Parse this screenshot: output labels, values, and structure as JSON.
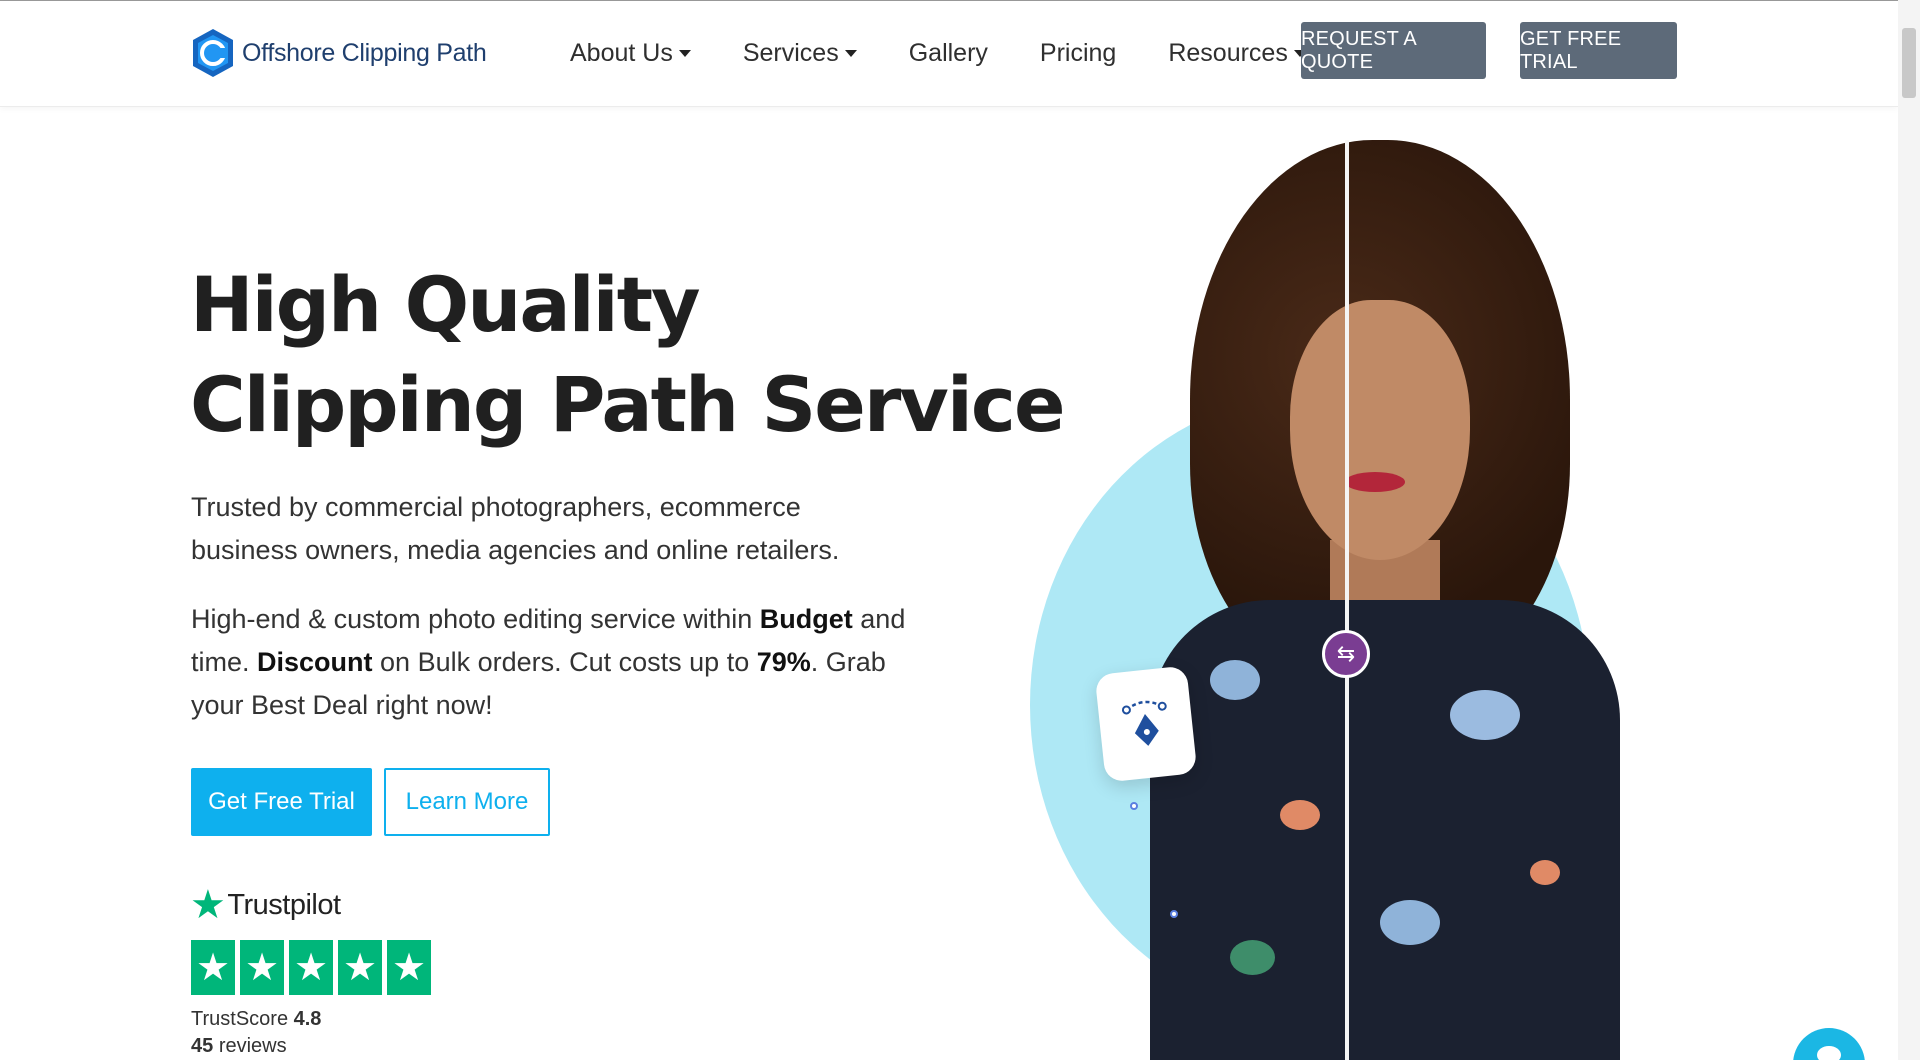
{
  "header": {
    "logo_text": "Offshore Clipping Path",
    "nav": [
      {
        "label": "About Us",
        "dropdown": true
      },
      {
        "label": "Services",
        "dropdown": true
      },
      {
        "label": "Gallery",
        "dropdown": false
      },
      {
        "label": "Pricing",
        "dropdown": false
      },
      {
        "label": "Resources",
        "dropdown": true
      }
    ],
    "request_quote_label": "REQUEST A QUOTE",
    "free_trial_label": "GET FREE TRIAL"
  },
  "hero": {
    "title_line1": "High Quality",
    "title_line2": "Clipping Path Service",
    "paragraph1": "Trusted by commercial photographers, ecommerce business owners, media agencies and online retailers.",
    "paragraph2": {
      "part1": "High-end & custom photo editing service within ",
      "bold1": "Budget",
      "part2": " and time. ",
      "bold2": "Discount",
      "part3": " on Bulk orders. Cut costs up to ",
      "bold3": "79%",
      "part4": ". Grab your Best Deal right now!"
    },
    "cta_primary": "Get Free Trial",
    "cta_secondary": "Learn More"
  },
  "trustpilot": {
    "brand": "Trustpilot",
    "stars": 5,
    "score_label": "TrustScore",
    "score_value": "4.8",
    "reviews_count": "45",
    "reviews_label": "reviews"
  },
  "colors": {
    "accent": "#0eb0ee",
    "header_button": "#5d6a79",
    "trustpilot_green": "#00b67a",
    "logo_blue": "#1f3f6e",
    "compare_handle": "#7a3d92"
  },
  "icons": {
    "logo": "logo-mark-icon",
    "compare": "swap-arrows-icon",
    "pen_tool": "pen-tool-icon",
    "chat": "chat-icon"
  }
}
